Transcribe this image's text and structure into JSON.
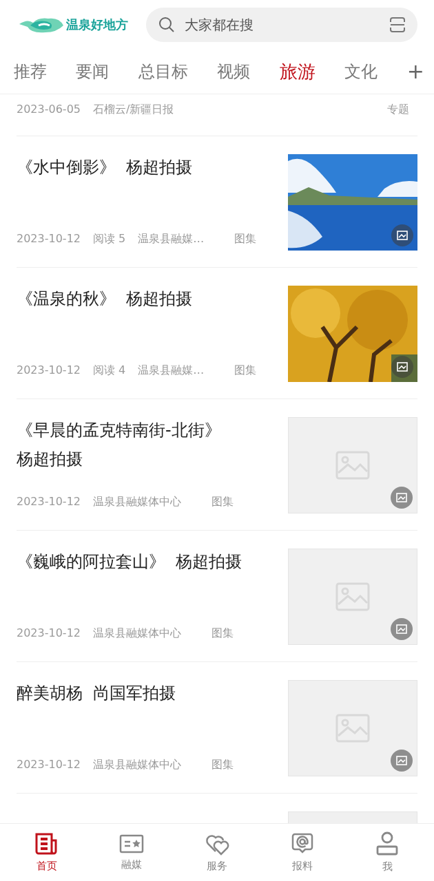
{
  "header": {
    "logo_text": "温泉好地方",
    "search": {
      "placeholder": "大家都在搜"
    }
  },
  "tabs": [
    {
      "label": "推荐",
      "selected": false
    },
    {
      "label": "要闻",
      "selected": false
    },
    {
      "label": "总目标",
      "selected": false
    },
    {
      "label": "视频",
      "selected": false
    },
    {
      "label": "旅游",
      "selected": true
    },
    {
      "label": "文化",
      "selected": false
    }
  ],
  "tabs_more": "+",
  "feed": {
    "top_item": {
      "date": "2023-06-05",
      "source": "石榴云/新疆日报",
      "tag": "专题"
    },
    "items": [
      {
        "title": "《水中倒影》  杨超拍摄",
        "date": "2023-10-12",
        "reads": "阅读 5",
        "source": "温泉县融媒…",
        "tag": "图集"
      },
      {
        "title": "《温泉的秋》  杨超拍摄",
        "date": "2023-10-12",
        "reads": "阅读 4",
        "source": "温泉县融媒…",
        "tag": "图集"
      },
      {
        "title": "《早晨的孟克特南街-北街》杨超拍摄",
        "date": "2023-10-12",
        "source": "温泉县融媒体中心",
        "tag": "图集"
      },
      {
        "title": "《巍峨的阿拉套山》  杨超拍摄",
        "date": "2023-10-12",
        "source": "温泉县融媒体中心",
        "tag": "图集"
      },
      {
        "title": "醉美胡杨  尚国军拍摄",
        "date": "2023-10-12",
        "source": "温泉县融媒体中心",
        "tag": "图集"
      }
    ]
  },
  "bottom_nav": [
    {
      "label": "首页",
      "selected": true
    },
    {
      "label": "融媒",
      "selected": false
    },
    {
      "label": "服务",
      "selected": false
    },
    {
      "label": "报料",
      "selected": false
    },
    {
      "label": "我",
      "selected": false
    }
  ]
}
